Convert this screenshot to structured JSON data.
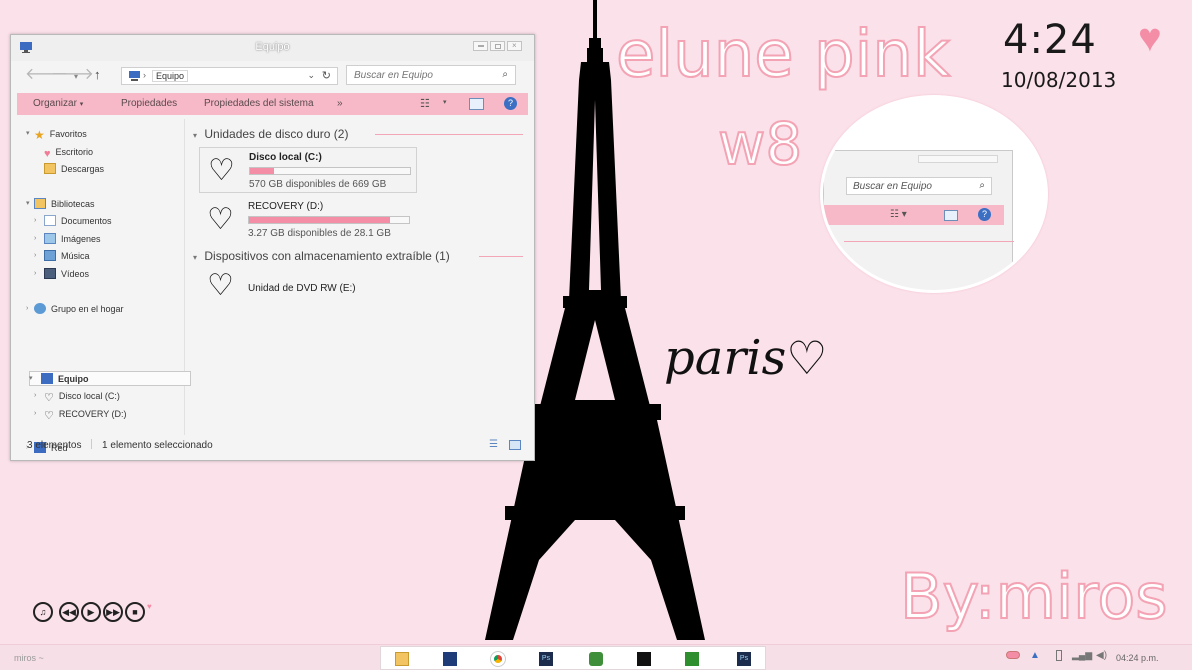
{
  "window": {
    "title": "Equipo",
    "address": {
      "crumb": "Equipo"
    },
    "search": {
      "placeholder": "Buscar en Equipo"
    },
    "ribbon": {
      "organize": "Organizar",
      "properties": "Propiedades",
      "system_properties": "Propiedades del sistema",
      "more": "»"
    },
    "sidebar": {
      "favorites": "Favoritos",
      "desktop": "Escritorio",
      "downloads": "Descargas",
      "libraries": "Bibliotecas",
      "documents": "Documentos",
      "images": "Imágenes",
      "music": "Música",
      "videos": "Vídeos",
      "homegroup": "Grupo en el hogar",
      "computer": "Equipo",
      "local_disk": "Disco local (C:)",
      "recovery": "RECOVERY (D:)",
      "network": "Red"
    },
    "groups": {
      "hard_drives": "Unidades de disco duro (2)",
      "removable": "Dispositivos con almacenamiento extraíble (1)"
    },
    "drives": [
      {
        "name": "Disco local (C:)",
        "free": "570 GB disponibles de 669 GB",
        "used_fraction": 0.15
      },
      {
        "name": "RECOVERY (D:)",
        "free": "3.27 GB disponibles de 28.1 GB",
        "used_fraction": 0.88
      }
    ],
    "dvd": {
      "name": "Unidad de DVD RW (E:)"
    },
    "status": {
      "count": "3 elementos",
      "selected": "1 elemento seleccionado"
    }
  },
  "desktop": {
    "clock": "4:24",
    "date": "10/08/2013",
    "title_text": "elune pink",
    "version_text": "w8",
    "paris_text": "paris",
    "author_text": "By:miros",
    "zoom_search": "Buscar en Equipo"
  },
  "taskbar": {
    "label": "miros ~",
    "time": "04:24 p.m."
  },
  "colors": {
    "accent_pink": "#f7b9c7",
    "progress_pink": "#f48ea7",
    "background": "#fbe1ea"
  }
}
